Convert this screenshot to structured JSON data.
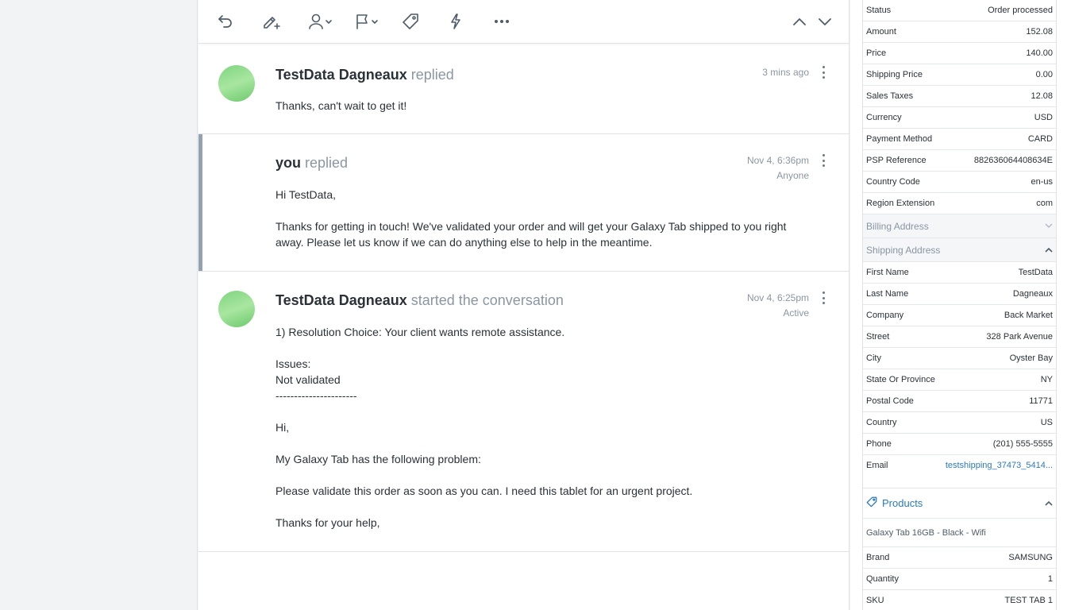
{
  "toolbar": {
    "reply": "reply-icon",
    "note": "note-icon",
    "assign": "assign-icon",
    "flag": "flag-icon",
    "tag": "tag-icon",
    "workflow": "workflow-icon",
    "more": "more-icon",
    "prev": "chevron-up-icon",
    "next": "chevron-down-icon"
  },
  "thread": [
    {
      "author": "TestData Dagneaux",
      "action": "replied",
      "time": "3 mins ago",
      "subtime": "",
      "body": [
        "Thanks, can't wait to get it!"
      ]
    },
    {
      "author": "you",
      "action": "replied",
      "time": "Nov 4, 6:36pm",
      "subtime": "Anyone",
      "body": [
        "Hi TestData,",
        "",
        "Thanks for getting in touch! We've validated your order and will get your Galaxy Tab shipped to you right away. Please let us know if we can do anything else to help in the meantime."
      ]
    },
    {
      "author": "TestData Dagneaux",
      "action": "started the conversation",
      "time": "Nov 4, 6:25pm",
      "subtime": "Active",
      "body": [
        "1) Resolution Choice: Your client wants remote assistance.",
        "",
        "Issues:",
        "Not validated",
        "----------------------",
        "",
        "Hi,",
        "",
        "My Galaxy Tab has the following problem:",
        "",
        "Please validate this order as soon as you can. I need this tablet for an urgent project.",
        "",
        "Thanks for your help,"
      ]
    }
  ],
  "order": [
    {
      "k": "Status",
      "v": "Order processed"
    },
    {
      "k": "Amount",
      "v": "152.08"
    },
    {
      "k": "Price",
      "v": "140.00"
    },
    {
      "k": "Shipping Price",
      "v": "0.00"
    },
    {
      "k": "Sales Taxes",
      "v": "12.08"
    },
    {
      "k": "Currency",
      "v": "USD"
    },
    {
      "k": "Payment Method",
      "v": "CARD"
    },
    {
      "k": "PSP Reference",
      "v": "882636064408634E"
    },
    {
      "k": "Country Code",
      "v": "en-us"
    },
    {
      "k": "Region Extension",
      "v": "com"
    }
  ],
  "billing_label": "Billing Address",
  "shipping_label": "Shipping Address",
  "shipping": [
    {
      "k": "First Name",
      "v": "TestData"
    },
    {
      "k": "Last Name",
      "v": "Dagneaux"
    },
    {
      "k": "Company",
      "v": "Back Market"
    },
    {
      "k": "Street",
      "v": "328 Park Avenue"
    },
    {
      "k": "City",
      "v": "Oyster Bay"
    },
    {
      "k": "State Or Province",
      "v": "NY"
    },
    {
      "k": "Postal Code",
      "v": "11771"
    },
    {
      "k": "Country",
      "v": "US"
    },
    {
      "k": "Phone",
      "v": "(201) 555-5555"
    }
  ],
  "email": {
    "k": "Email",
    "v": "testshipping_37473_5414..."
  },
  "products_label": "Products",
  "product_name": "Galaxy Tab 16GB - Black - Wifi",
  "product_fields": [
    {
      "k": "Brand",
      "v": "SAMSUNG"
    },
    {
      "k": "Quantity",
      "v": "1"
    },
    {
      "k": "SKU",
      "v": "TEST TAB 1"
    }
  ],
  "colors": {
    "accent": "#2a7ac0",
    "muted": "#8a96a3",
    "note_bar": "#93a1b0"
  }
}
